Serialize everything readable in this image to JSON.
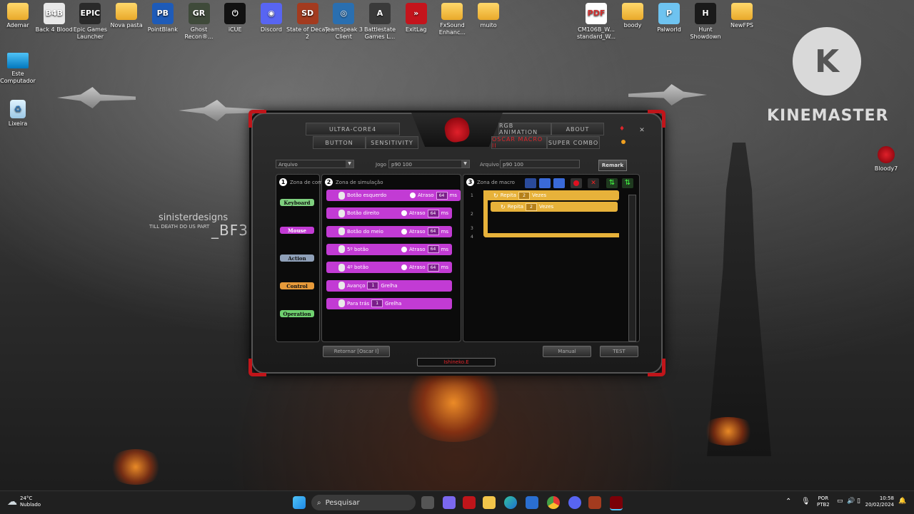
{
  "desktop": {
    "icons": [
      {
        "label": "Ademar",
        "icon": "folder-icon",
        "kind": "folder"
      },
      {
        "label": "Back 4 Blood",
        "icon": "back4blood-icon",
        "kind": "app",
        "color": "#e8e8e8",
        "glyph": "B4B"
      },
      {
        "label": "Epic Games Launcher",
        "icon": "epic-games-icon",
        "kind": "app",
        "color": "#2a2a2a",
        "glyph": "EPIC"
      },
      {
        "label": "Nova pasta",
        "icon": "folder-icon",
        "kind": "folder"
      },
      {
        "label": "PointBlank",
        "icon": "pointblank-icon",
        "kind": "app",
        "color": "#1e5bb8",
        "glyph": "PB"
      },
      {
        "label": "Ghost Recon®...",
        "icon": "ghost-recon-icon",
        "kind": "app",
        "color": "#3f4a3a",
        "glyph": "GR"
      },
      {
        "label": "iCUE",
        "icon": "icue-icon",
        "kind": "app",
        "color": "#111111",
        "glyph": "⏻"
      },
      {
        "label": "Discord",
        "icon": "discord-icon",
        "kind": "app",
        "color": "#5865f2",
        "glyph": "◉"
      },
      {
        "label": "State of Decay 2",
        "icon": "state-of-decay-icon",
        "kind": "app",
        "color": "#a33b1f",
        "glyph": "SD"
      },
      {
        "label": "TeamSpeak 3 Client",
        "icon": "teamspeak-icon",
        "kind": "app",
        "color": "#2a6fb0",
        "glyph": "◎"
      },
      {
        "label": "Battlestate Games L...",
        "icon": "battlestate-icon",
        "kind": "app",
        "color": "#3a3a3a",
        "glyph": "A"
      },
      {
        "label": "ExitLag",
        "icon": "exitlag-icon",
        "kind": "app",
        "color": "#c4141c",
        "glyph": "»"
      },
      {
        "label": "FxSound Enhanc...",
        "icon": "folder-icon",
        "kind": "folder"
      },
      {
        "label": "muito",
        "icon": "folder-icon",
        "kind": "folder"
      }
    ],
    "right_icons": [
      {
        "label": "CM106B_W... standard_W...",
        "icon": "pdf-icon",
        "kind": "app",
        "color": "#ffffff",
        "glyph": "PDF"
      },
      {
        "label": "boody",
        "icon": "folder-icon",
        "kind": "folder"
      },
      {
        "label": "Palworld",
        "icon": "palworld-icon",
        "kind": "app",
        "color": "#6ec3f0",
        "glyph": "P"
      },
      {
        "label": "Hunt Showdown",
        "icon": "hunt-showdown-icon",
        "kind": "app",
        "color": "#1a1a1a",
        "glyph": "H"
      },
      {
        "label": "NewFPS",
        "icon": "folder-icon",
        "kind": "folder"
      }
    ],
    "left_column": [
      {
        "label": "Este Computador",
        "icon": "monitor-icon"
      },
      {
        "label": "Lixeira",
        "icon": "recycle-bin-icon"
      }
    ],
    "bloody7": {
      "label": "Bloody7",
      "icon": "bloody7-icon"
    },
    "wallpaper": {
      "brand_line1": "sinisterdesigns",
      "brand_line2": "TILL DEATH DO US PART",
      "brand_tag": "_BF3"
    },
    "kinemaster": {
      "letter": "K",
      "text": "KINEMASTER"
    }
  },
  "app": {
    "tabs": {
      "ultra_core": "Ultra-Core4",
      "button": "Button",
      "sensitivity": "Sensitivity",
      "rgb": "RGB Animation",
      "about": "About",
      "oscar": "Oscar Macro II",
      "super_combo": "Super Combo"
    },
    "file_select": "Arquivo",
    "game_label": "Jogo",
    "game_value": "p90 100",
    "arquivo_label": "Arquivo",
    "arquivo_value": "p90 100",
    "remark": "Remark",
    "zone_command": {
      "title": "Zona de com",
      "num": "1",
      "buttons": [
        "Keyboard",
        "Mouse",
        "Action",
        "Control",
        "Operation"
      ],
      "colors": [
        "#7fd07f",
        "#c23bd4",
        "#8fa0b8",
        "#e79a3a",
        "#6fd06f"
      ]
    },
    "zone_sim": {
      "title": "Zona de simulação",
      "num": "2",
      "rows": [
        {
          "label": "Botão esquerdo",
          "delay_label": "Atraso",
          "delay": "64",
          "unit": "ms"
        },
        {
          "label": "Botão direito",
          "delay_label": "Atraso",
          "delay": "64",
          "unit": "ms"
        },
        {
          "label": "Botão do meio",
          "delay_label": "Atraso",
          "delay": "64",
          "unit": "ms"
        },
        {
          "label": "5º botão",
          "delay_label": "Atraso",
          "delay": "64",
          "unit": "ms"
        },
        {
          "label": "4º botão",
          "delay_label": "Atraso",
          "delay": "64",
          "unit": "ms"
        },
        {
          "label": "Avanço",
          "value": "1",
          "suffix": "Grelha"
        },
        {
          "label": "Para trás",
          "value": "1",
          "suffix": "Grelha"
        }
      ]
    },
    "zone_macro": {
      "title": "Zona de macro",
      "num": "3",
      "line_numbers": [
        "1",
        "2",
        "3",
        "4"
      ],
      "outer": {
        "label": "Repita",
        "count": "2",
        "suffix": "Vezes"
      },
      "inner": {
        "label": "Repita",
        "count": "2",
        "suffix": "Vezes"
      }
    },
    "bottom": {
      "return": "Retornar [Oscar I]",
      "manual": "Manual",
      "test": "TEST",
      "status": "Ishineko.E"
    }
  },
  "taskbar": {
    "weather_temp": "24°C",
    "weather_desc": "Nublado",
    "search_placeholder": "Pesquisar",
    "lang1": "POR",
    "lang2": "PTB2",
    "time": "10:58",
    "date": "20/02/2024"
  }
}
